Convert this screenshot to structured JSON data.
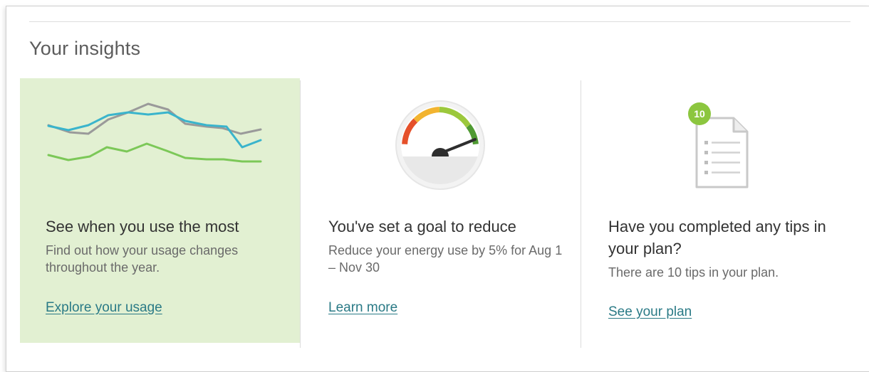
{
  "section": {
    "title": "Your insights"
  },
  "colors": {
    "highlight_card_bg": "#e2f0d2",
    "link": "#2a7a86",
    "teal_line": "#3ab4cc",
    "gray_line": "#9a9a9a",
    "green_line": "#7cc858",
    "badge_green": "#8cc63f"
  },
  "cards": [
    {
      "icon": "usage-line-chart-icon",
      "title": "See when you use the most",
      "description": "Find out how your usage changes throughout the year.",
      "link": "Explore your usage"
    },
    {
      "icon": "speedometer-gauge-icon",
      "title": "You've set a goal to reduce",
      "description": "Reduce your energy use by 5% for Aug 1 – Nov 30",
      "link": "Learn more"
    },
    {
      "icon": "plan-document-icon",
      "badge": "10",
      "title": "Have you completed any tips in your plan?",
      "description": "There are 10 tips in your plan.",
      "link": "See your plan"
    }
  ]
}
